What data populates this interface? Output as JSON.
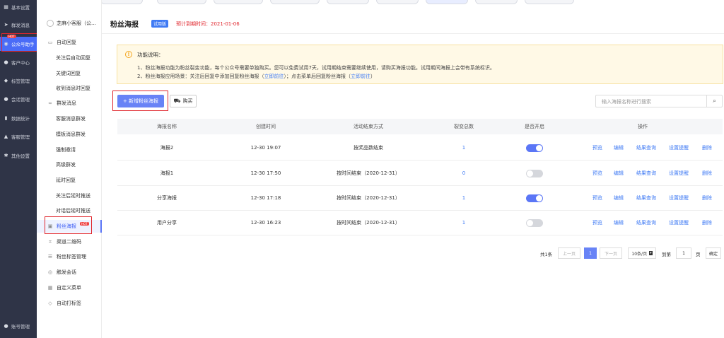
{
  "leftnav": {
    "items": [
      {
        "label": "基本设置",
        "icon": "grid-icon"
      },
      {
        "label": "群发消息",
        "icon": "send-icon"
      },
      {
        "label": "公众号助手",
        "icon": "assistant-icon",
        "badge": "HOT"
      },
      {
        "label": "客户中心",
        "icon": "users-icon"
      },
      {
        "label": "标签管理",
        "icon": "tag-icon"
      },
      {
        "label": "会话管理",
        "icon": "chat-icon"
      },
      {
        "label": "数据统计",
        "icon": "bar-chart-icon"
      },
      {
        "label": "客服管理",
        "icon": "service-icon"
      },
      {
        "label": "其他设置",
        "icon": "settings-icon"
      },
      {
        "label": "账号管理",
        "icon": "account-icon"
      }
    ]
  },
  "subnav": {
    "account": "芝麻小客服（公...",
    "items": [
      {
        "label": "自动回复",
        "icon": "reply-icon",
        "level": 1
      },
      {
        "label": "关注后自动回复",
        "level": 2
      },
      {
        "label": "关键词回复",
        "level": 2
      },
      {
        "label": "收到消息时回复",
        "level": 2
      },
      {
        "label": "群发消息",
        "icon": "group-icon",
        "level": 1
      },
      {
        "label": "客服消息群发",
        "level": 2
      },
      {
        "label": "模板消息群发",
        "level": 2
      },
      {
        "label": "强制邀请",
        "level": 2
      },
      {
        "label": "高级群发",
        "level": 2
      },
      {
        "label": "延时回复",
        "level": 2
      },
      {
        "label": "关注后延时推送",
        "level": 2
      },
      {
        "label": "对话后延时推送",
        "level": 2
      },
      {
        "label": "粉丝海报",
        "icon": "poster-icon",
        "level": 1,
        "badge": "HOT"
      },
      {
        "label": "渠道二维码",
        "icon": "qrcode-icon",
        "level": 1
      },
      {
        "label": "粉丝标签管理",
        "icon": "label-icon",
        "level": 1
      },
      {
        "label": "触发会话",
        "icon": "trigger-icon",
        "level": 1
      },
      {
        "label": "自定义菜单",
        "icon": "menu-icon",
        "level": 1
      },
      {
        "label": "自动打标签",
        "icon": "auto-tag-icon",
        "level": 1
      }
    ]
  },
  "header": {
    "title": "粉丝海报",
    "badge": "试用版",
    "expire": "预计到期时间：2021-01-06"
  },
  "notice": {
    "title": "功能说明：",
    "line1": "1、粉丝海报功能为粉丝裂变功能，每个公众号需要单独购买。您可以免费试用7天，试用期结束需要继续使用，请购买海报功能。试用期间海报上会带有系统标识。",
    "line2_prefix": "2、粉丝海报应用场景：关注后回复中添加回复粉丝海报（",
    "line2_link1": "立即前往",
    "line2_mid": "）；点击菜单后回复粉丝海报（",
    "line2_link2": "立即前往",
    "line2_suffix": "）"
  },
  "toolbar": {
    "new_label": "+ 新增粉丝海报",
    "buy_label": "购买",
    "search_placeholder": "输入海报名称进行搜索"
  },
  "table": {
    "headers": [
      "海报名称",
      "创建时间",
      "活动结束方式",
      "裂变总数",
      "是否开启",
      "操作"
    ],
    "rows": [
      {
        "name": "海报2",
        "created": "12-30 19:07",
        "end": "按奖品数结束",
        "total": "1",
        "enabled": true
      },
      {
        "name": "海报1",
        "created": "12-30 17:50",
        "end": "按时间结束（2020-12-31）",
        "total": "0",
        "enabled": false
      },
      {
        "name": "分享海报",
        "created": "12-30 17:18",
        "end": "按时间结束（2020-12-31）",
        "total": "1",
        "enabled": true
      },
      {
        "name": "用户分享",
        "created": "12-30 16:23",
        "end": "按时间结束（2020-12-31）",
        "total": "1",
        "enabled": false
      }
    ],
    "ops": [
      "预览",
      "编辑",
      "结果查询",
      "设置提醒",
      "删除"
    ]
  },
  "pagination": {
    "total": "共1条",
    "prev": "上一页",
    "current": "1",
    "next": "下一页",
    "page_size": "10条/页",
    "goto": "到第",
    "goto_value": "1",
    "page_unit": "页",
    "confirm": "确定"
  },
  "colors": {
    "accent": "#5b76f6",
    "sidebar": "#2f3447",
    "highlight_border": "#e0262d"
  }
}
